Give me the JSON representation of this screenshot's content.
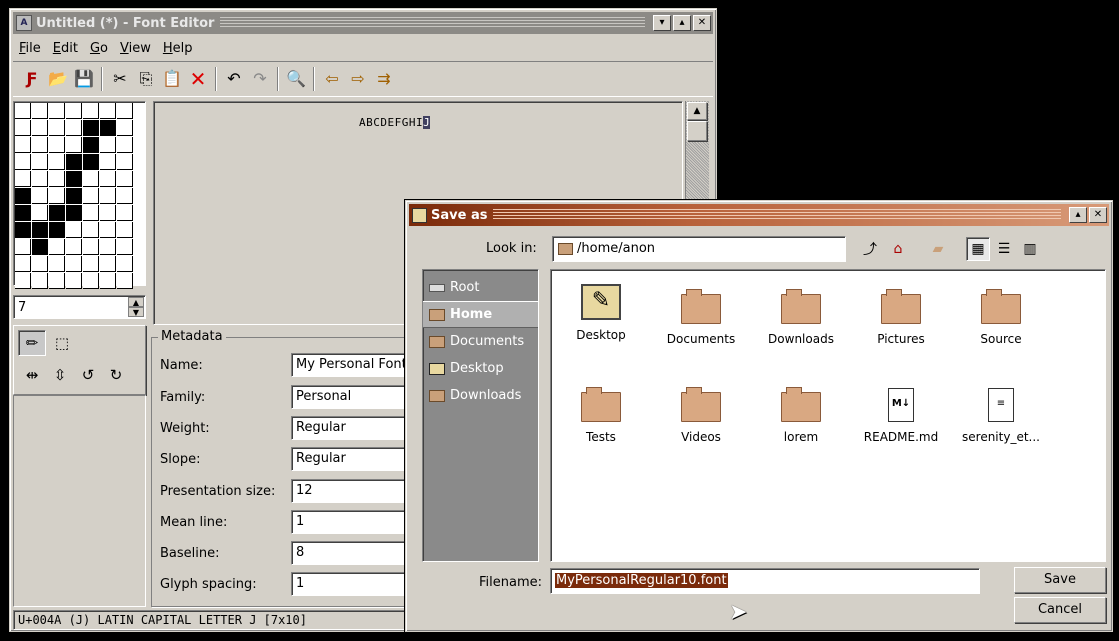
{
  "editor": {
    "title": "Untitled (*) - Font Editor",
    "menu": [
      {
        "mnemonic": "F",
        "rest": "ile"
      },
      {
        "mnemonic": "E",
        "rest": "dit"
      },
      {
        "mnemonic": "G",
        "rest": "o"
      },
      {
        "mnemonic": "V",
        "rest": "iew"
      },
      {
        "mnemonic": "H",
        "rest": "elp"
      }
    ],
    "glyph_value": "7",
    "sample_text": "ABCDEFGHI",
    "sample_selected": "J",
    "metadata": {
      "legend": "Metadata",
      "rows": [
        {
          "label": "Name:",
          "value": "My Personal Font"
        },
        {
          "label": "Family:",
          "value": "Personal"
        },
        {
          "label": "Weight:",
          "value": "Regular"
        },
        {
          "label": "Slope:",
          "value": "Regular"
        },
        {
          "label": "Presentation size:",
          "value": "12"
        },
        {
          "label": "Mean line:",
          "value": "1"
        },
        {
          "label": "Baseline:",
          "value": "8"
        },
        {
          "label": "Glyph spacing:",
          "value": "1"
        }
      ]
    },
    "status": "U+004A (J) LATIN CAPITAL LETTER J [7x10]"
  },
  "dialog": {
    "title": "Save as",
    "look_in_label": "Look in:",
    "look_in_value": "/home/anon",
    "places": [
      {
        "label": "Root",
        "icon": "drive-icon"
      },
      {
        "label": "Home",
        "icon": "home-folder-icon",
        "active": true
      },
      {
        "label": "Documents",
        "icon": "folder-icon"
      },
      {
        "label": "Desktop",
        "icon": "desktop-icon"
      },
      {
        "label": "Downloads",
        "icon": "folder-icon"
      }
    ],
    "files": [
      {
        "name": "Desktop",
        "kind": "desktop"
      },
      {
        "name": "Documents",
        "kind": "folder"
      },
      {
        "name": "Downloads",
        "kind": "folder"
      },
      {
        "name": "Pictures",
        "kind": "folder"
      },
      {
        "name": "Source",
        "kind": "folder"
      },
      {
        "name": "Tests",
        "kind": "folder"
      },
      {
        "name": "Videos",
        "kind": "folder"
      },
      {
        "name": "lorem",
        "kind": "folder"
      },
      {
        "name": "README.md",
        "kind": "markdown"
      },
      {
        "name": "serenity_et...",
        "kind": "text"
      }
    ],
    "filename_label": "Filename:",
    "filename_value": "MyPersonalRegular10.font",
    "save_label": "Save",
    "cancel_label": "Cancel"
  },
  "colors": {
    "window_bg": "#d4d0c8",
    "dialog_title_accent": "#7a2a0a",
    "places_bg": "#8a8a8a"
  }
}
